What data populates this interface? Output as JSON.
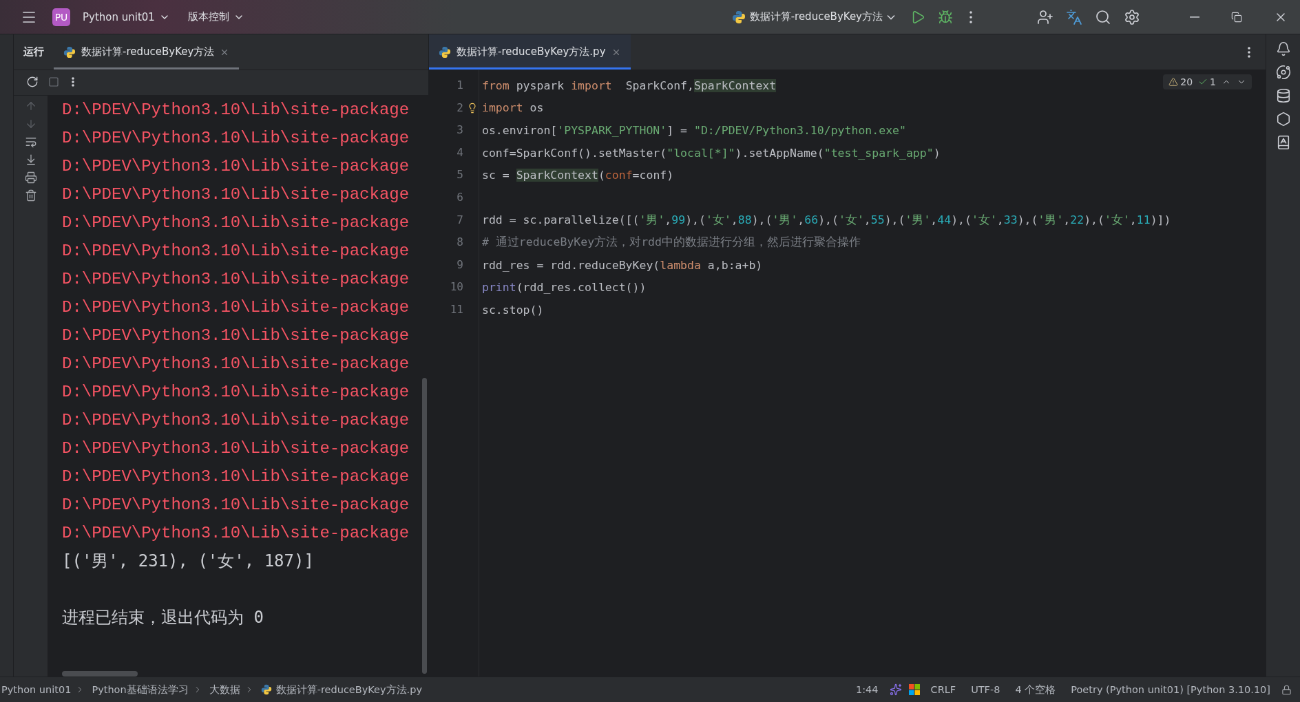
{
  "title_bar": {
    "project_badge": "PU",
    "project": "Python unit01",
    "vcs": "版本控制",
    "run_config": "数据计算-reduceByKey方法"
  },
  "run_panel": {
    "label": "运行",
    "tabs": [
      {
        "label": "数据计算-reduceByKey方法",
        "selected": true
      }
    ],
    "console": [
      {
        "kind": "error",
        "text": "D:\\PDEV\\Python3.10\\Lib\\site-package"
      },
      {
        "kind": "error",
        "text": "D:\\PDEV\\Python3.10\\Lib\\site-package"
      },
      {
        "kind": "error",
        "text": "D:\\PDEV\\Python3.10\\Lib\\site-package"
      },
      {
        "kind": "error",
        "text": "D:\\PDEV\\Python3.10\\Lib\\site-package"
      },
      {
        "kind": "error",
        "text": "D:\\PDEV\\Python3.10\\Lib\\site-package"
      },
      {
        "kind": "error",
        "text": "D:\\PDEV\\Python3.10\\Lib\\site-package"
      },
      {
        "kind": "error",
        "text": "D:\\PDEV\\Python3.10\\Lib\\site-package"
      },
      {
        "kind": "error",
        "text": "D:\\PDEV\\Python3.10\\Lib\\site-package"
      },
      {
        "kind": "error",
        "text": "D:\\PDEV\\Python3.10\\Lib\\site-package"
      },
      {
        "kind": "error",
        "text": "D:\\PDEV\\Python3.10\\Lib\\site-package"
      },
      {
        "kind": "error",
        "text": "D:\\PDEV\\Python3.10\\Lib\\site-package"
      },
      {
        "kind": "error",
        "text": "D:\\PDEV\\Python3.10\\Lib\\site-package"
      },
      {
        "kind": "error",
        "text": "D:\\PDEV\\Python3.10\\Lib\\site-package"
      },
      {
        "kind": "error",
        "text": "D:\\PDEV\\Python3.10\\Lib\\site-package"
      },
      {
        "kind": "error",
        "text": "D:\\PDEV\\Python3.10\\Lib\\site-package"
      },
      {
        "kind": "error",
        "text": "D:\\PDEV\\Python3.10\\Lib\\site-package"
      },
      {
        "kind": "output",
        "text": "[('男', 231), ('女', 187)]"
      },
      {
        "kind": "info",
        "text": "进程已结束，退出代码为 0"
      }
    ]
  },
  "editor": {
    "tabs": [
      {
        "label": "数据计算-reduceByKey方法.py",
        "selected": true
      }
    ],
    "inspections": {
      "warnings": "20",
      "typos": "1"
    },
    "lines": [
      {
        "number": "1",
        "tokens": [
          {
            "kind": "keyword",
            "text": "from"
          },
          {
            "kind": "plain",
            "text": " pyspark "
          },
          {
            "kind": "keyword",
            "text": "import"
          },
          {
            "kind": "plain",
            "text": "  SparkConf,"
          },
          {
            "kind": "usage",
            "text": "SparkContext"
          }
        ]
      },
      {
        "number": "2",
        "bulb": true,
        "tokens": [
          {
            "kind": "keyword",
            "text": "import"
          },
          {
            "kind": "plain",
            "text": " os"
          }
        ]
      },
      {
        "number": "3",
        "tokens": [
          {
            "kind": "plain",
            "text": "os.environ["
          },
          {
            "kind": "string",
            "text": "'PYSPARK_PYTHON'"
          },
          {
            "kind": "plain",
            "text": "] = "
          },
          {
            "kind": "string",
            "text": "\"D:/PDEV/Python3.10/python.exe\""
          }
        ]
      },
      {
        "number": "4",
        "tokens": [
          {
            "kind": "plain",
            "text": "conf=SparkConf().setMaster("
          },
          {
            "kind": "string",
            "text": "\"local[*]\""
          },
          {
            "kind": "plain",
            "text": ").setAppName("
          },
          {
            "kind": "string",
            "text": "\"test_spark_app\""
          },
          {
            "kind": "plain",
            "text": ")"
          }
        ]
      },
      {
        "number": "5",
        "tokens": [
          {
            "kind": "plain",
            "text": "sc = "
          },
          {
            "kind": "usage",
            "text": "SparkContext"
          },
          {
            "kind": "plain",
            "text": "("
          },
          {
            "kind": "param",
            "text": "conf"
          },
          {
            "kind": "plain",
            "text": "=conf)"
          }
        ]
      },
      {
        "number": "6"
      },
      {
        "number": "7",
        "tokens": [
          {
            "kind": "plain",
            "text": "rdd = sc.parallelize([("
          },
          {
            "kind": "string",
            "text": "'男'"
          },
          {
            "kind": "plain",
            "text": ","
          },
          {
            "kind": "number",
            "text": "99"
          },
          {
            "kind": "plain",
            "text": "),("
          },
          {
            "kind": "string",
            "text": "'女'"
          },
          {
            "kind": "plain",
            "text": ","
          },
          {
            "kind": "number",
            "text": "88"
          },
          {
            "kind": "plain",
            "text": "),("
          },
          {
            "kind": "string",
            "text": "'男'"
          },
          {
            "kind": "plain",
            "text": ","
          },
          {
            "kind": "number",
            "text": "66"
          },
          {
            "kind": "plain",
            "text": "),("
          },
          {
            "kind": "string",
            "text": "'女'"
          },
          {
            "kind": "plain",
            "text": ","
          },
          {
            "kind": "number",
            "text": "55"
          },
          {
            "kind": "plain",
            "text": "),("
          },
          {
            "kind": "string",
            "text": "'男'"
          },
          {
            "kind": "plain",
            "text": ","
          },
          {
            "kind": "number",
            "text": "44"
          },
          {
            "kind": "plain",
            "text": "),("
          },
          {
            "kind": "string",
            "text": "'女'"
          },
          {
            "kind": "plain",
            "text": ","
          },
          {
            "kind": "number",
            "text": "33"
          },
          {
            "kind": "plain",
            "text": "),("
          },
          {
            "kind": "string",
            "text": "'男'"
          },
          {
            "kind": "plain",
            "text": ","
          },
          {
            "kind": "number",
            "text": "22"
          },
          {
            "kind": "plain",
            "text": "),("
          },
          {
            "kind": "string",
            "text": "'女'"
          },
          {
            "kind": "plain",
            "text": ","
          },
          {
            "kind": "number",
            "text": "11"
          },
          {
            "kind": "plain",
            "text": ")])"
          }
        ]
      },
      {
        "number": "8",
        "tokens": [
          {
            "kind": "comment",
            "text": "# 通过reduceByKey方法，对rdd中的数据进行分组，然后进行聚合操作"
          }
        ]
      },
      {
        "number": "9",
        "tokens": [
          {
            "kind": "plain",
            "text": "rdd_res = rdd.reduceByKey("
          },
          {
            "kind": "keyword",
            "text": "lambda"
          },
          {
            "kind": "plain",
            "text": " a,b:a+b)"
          }
        ]
      },
      {
        "number": "10",
        "tokens": [
          {
            "kind": "builtin",
            "text": "print"
          },
          {
            "kind": "plain",
            "text": "(rdd_res.collect())"
          }
        ]
      },
      {
        "number": "11",
        "tokens": [
          {
            "kind": "plain",
            "text": "sc.stop()"
          }
        ]
      }
    ]
  },
  "status_bar": {
    "breadcrumbs": [
      "Python unit01",
      "Python基础语法学习",
      "大数据",
      "数据计算-reduceByKey方法.py"
    ],
    "position": "1:44",
    "line_separator": "CRLF",
    "encoding": "UTF-8",
    "indent": "4 个空格",
    "interpreter": "Poetry (Python unit01) [Python 3.10.10]"
  }
}
